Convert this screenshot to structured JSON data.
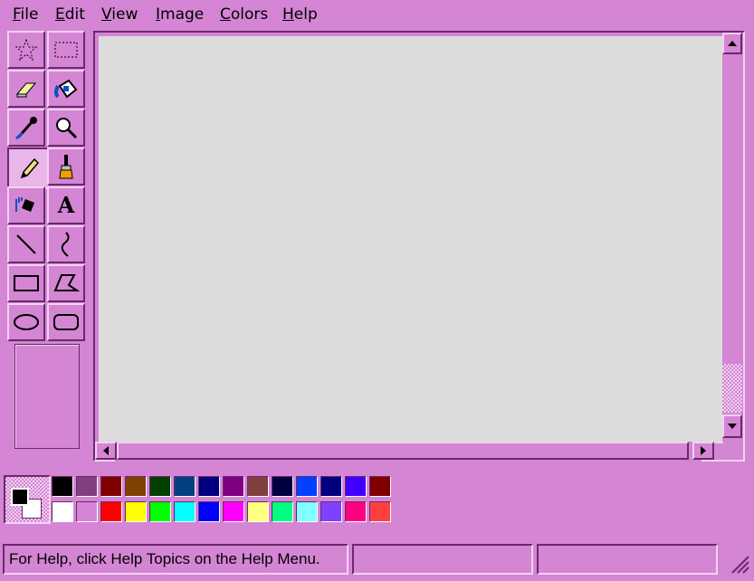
{
  "menu": [
    {
      "id": "file",
      "accel": "F",
      "rest": "ile"
    },
    {
      "id": "edit",
      "accel": "E",
      "rest": "dit"
    },
    {
      "id": "view",
      "accel": "V",
      "rest": "iew"
    },
    {
      "id": "image",
      "accel": "I",
      "rest": "mage"
    },
    {
      "id": "colors",
      "accel": "C",
      "rest": "olors"
    },
    {
      "id": "help",
      "accel": "H",
      "rest": "elp"
    }
  ],
  "tools": [
    {
      "name": "free-form-select",
      "icon": "star-select-icon",
      "active": false
    },
    {
      "name": "select",
      "icon": "rect-select-icon",
      "active": false
    },
    {
      "name": "eraser",
      "icon": "eraser-icon",
      "active": false
    },
    {
      "name": "fill-with-color",
      "icon": "paint-bucket-icon",
      "active": false
    },
    {
      "name": "pick-color",
      "icon": "eyedropper-icon",
      "active": false
    },
    {
      "name": "magnifier",
      "icon": "magnifier-icon",
      "active": false
    },
    {
      "name": "pencil",
      "icon": "pencil-icon",
      "active": true
    },
    {
      "name": "brush",
      "icon": "brush-icon",
      "active": false
    },
    {
      "name": "airbrush",
      "icon": "airbrush-icon",
      "active": false
    },
    {
      "name": "text",
      "icon": "text-icon",
      "active": false,
      "glyph": "A"
    },
    {
      "name": "line",
      "icon": "line-icon",
      "active": false
    },
    {
      "name": "curve",
      "icon": "curve-icon",
      "active": false
    },
    {
      "name": "rectangle",
      "icon": "rectangle-icon",
      "active": false
    },
    {
      "name": "polygon",
      "icon": "polygon-icon",
      "active": false
    },
    {
      "name": "ellipse",
      "icon": "ellipse-icon",
      "active": false
    },
    {
      "name": "rounded-rectangle",
      "icon": "rounded-rectangle-icon",
      "active": false
    }
  ],
  "palette": {
    "foreground": "#000000",
    "background": "#ffffff",
    "top_row": [
      "#000000",
      "#804080",
      "#800000",
      "#804000",
      "#004000",
      "#004080",
      "#000080",
      "#800080",
      "#804040",
      "#000040",
      "#0040ff",
      "#000080",
      "#4000ff",
      "#800000"
    ],
    "bottom_row": [
      "#ffffff",
      "#d485d4",
      "#ff0000",
      "#ffff00",
      "#00ff00",
      "#00ffff",
      "#0000ff",
      "#ff00ff",
      "#ffff80",
      "#00ff80",
      "#80ffff",
      "#8040ff",
      "#ff0080",
      "#ff4040"
    ]
  },
  "status": {
    "help_text": "For Help, click Help Topics on the Help Menu.",
    "coords": "",
    "size": ""
  }
}
